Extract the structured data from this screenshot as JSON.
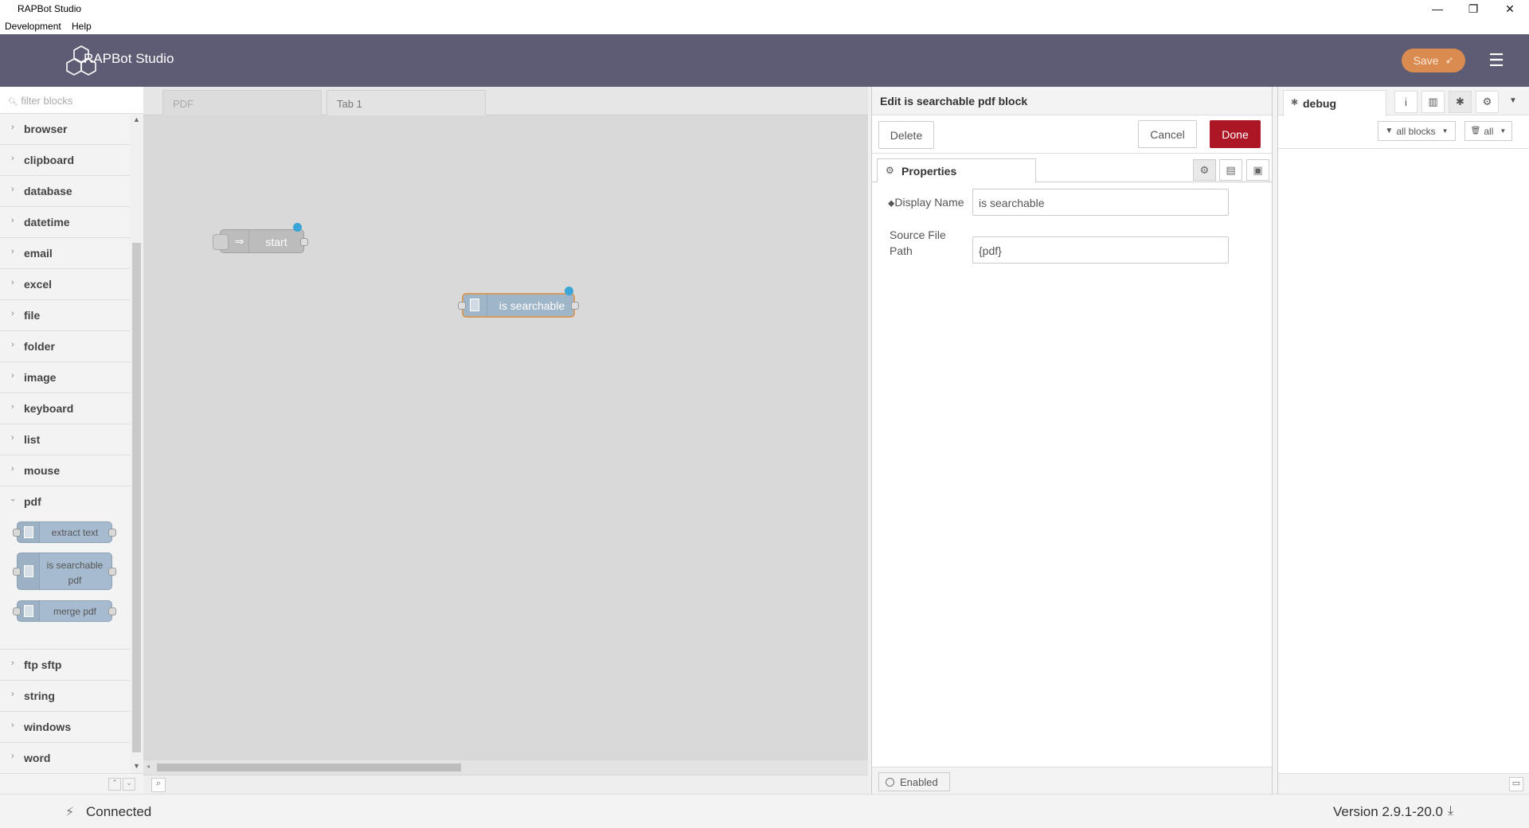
{
  "window": {
    "title": "RAPBot Studio",
    "controls": [
      "—",
      "❐",
      "✕"
    ]
  },
  "menubar": {
    "items": [
      "Development",
      "Help"
    ]
  },
  "header": {
    "brand": "RAPBot Studio",
    "save_label": "Save",
    "menu_icon": "hamburger-icon",
    "accent": "#5e5c74",
    "save_color": "#d98b50"
  },
  "palette": {
    "search_placeholder": "filter blocks",
    "categories_before": [
      "browser",
      "clipboard",
      "database",
      "datetime",
      "email",
      "excel",
      "file",
      "folder",
      "image",
      "keyboard",
      "list",
      "mouse"
    ],
    "open_category": "pdf",
    "pdf_blocks": [
      "extract text",
      "is searchable pdf",
      "merge pdf"
    ],
    "categories_after": [
      "ftp sftp",
      "string",
      "windows",
      "word"
    ]
  },
  "workspace": {
    "tabs": [
      "PDF",
      "Tab 1"
    ],
    "nodes": {
      "start": "start",
      "searchable": "is searchable"
    }
  },
  "tray": {
    "title": "Edit is searchable pdf block",
    "delete_label": "Delete",
    "cancel_label": "Cancel",
    "done_label": "Done",
    "done_color": "#ad1625",
    "properties_tab": "Properties",
    "fields": [
      {
        "label": "Display Name",
        "value": "is searchable"
      },
      {
        "label": "Source File Path",
        "value": "{pdf}"
      }
    ],
    "enabled_label": "Enabled"
  },
  "sidebar": {
    "tab": "debug",
    "filter_label": "all blocks",
    "clear_label": "all"
  },
  "status": {
    "connection": "Connected",
    "version": "Version 2.9.1-20.0"
  }
}
